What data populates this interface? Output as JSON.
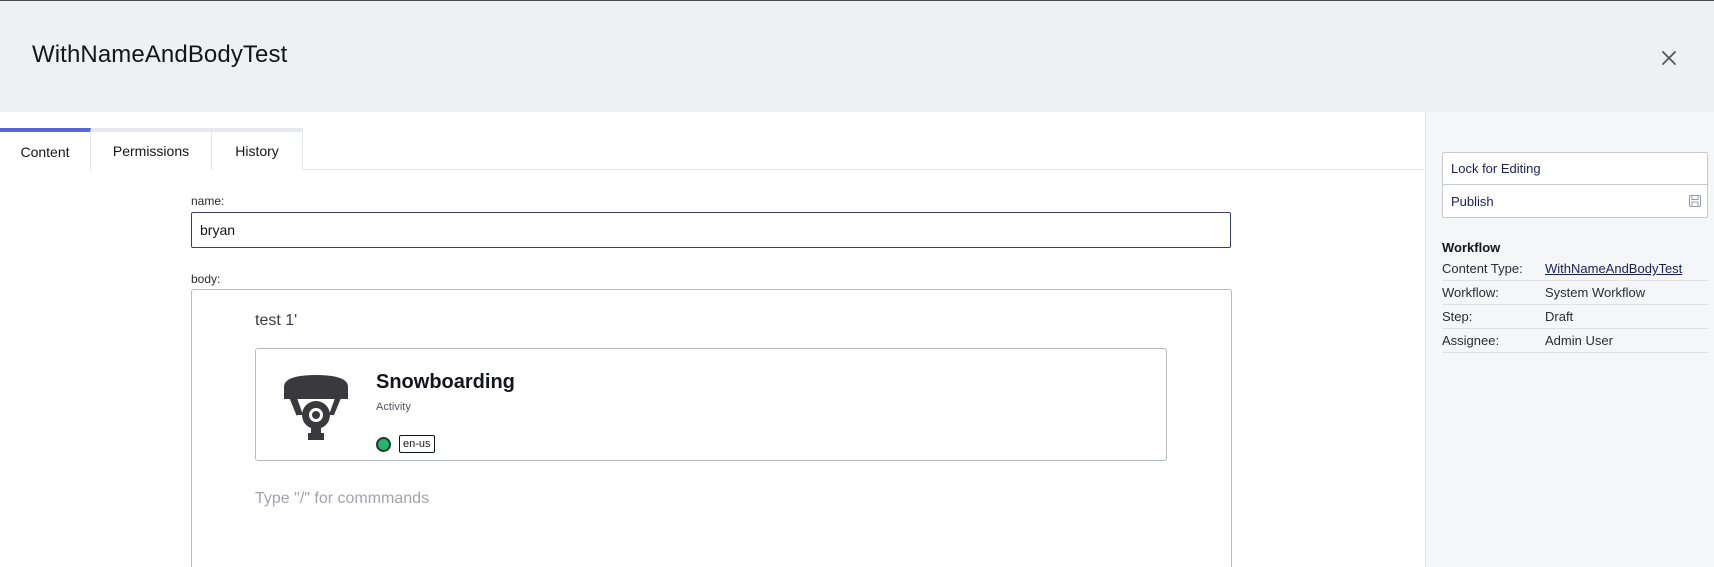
{
  "header": {
    "title": "WithNameAndBodyTest",
    "close_icon": "close-icon"
  },
  "tabs": [
    {
      "label": "Content",
      "active": true
    },
    {
      "label": "Permissions",
      "active": false
    },
    {
      "label": "History",
      "active": false
    }
  ],
  "form": {
    "name_label": "name:",
    "name_value": "bryan",
    "body_label": "body:"
  },
  "editor": {
    "text": "test 1'",
    "card": {
      "title": "Snowboarding",
      "subtitle": "Activity",
      "language": "en-us",
      "icon": "snowboard-lift-icon",
      "status_color": "#27b36a"
    },
    "placeholder": "Type \"/\" for commmands"
  },
  "sidebar": {
    "actions": [
      {
        "label": "Lock for Editing"
      },
      {
        "label": "Publish",
        "icon": "save-icon"
      }
    ],
    "workflow_heading": "Workflow",
    "workflow": [
      {
        "key": "Content Type:",
        "value": "WithNameAndBodyTest",
        "link": true
      },
      {
        "key": "Workflow:",
        "value": "System Workflow",
        "link": false
      },
      {
        "key": "Step:",
        "value": "Draft",
        "link": false
      },
      {
        "key": "Assignee:",
        "value": "Admin User",
        "link": false
      }
    ]
  },
  "colors": {
    "accent": "#5a64d4",
    "link": "#1a1f5a",
    "header_bg": "#eff0f2"
  }
}
